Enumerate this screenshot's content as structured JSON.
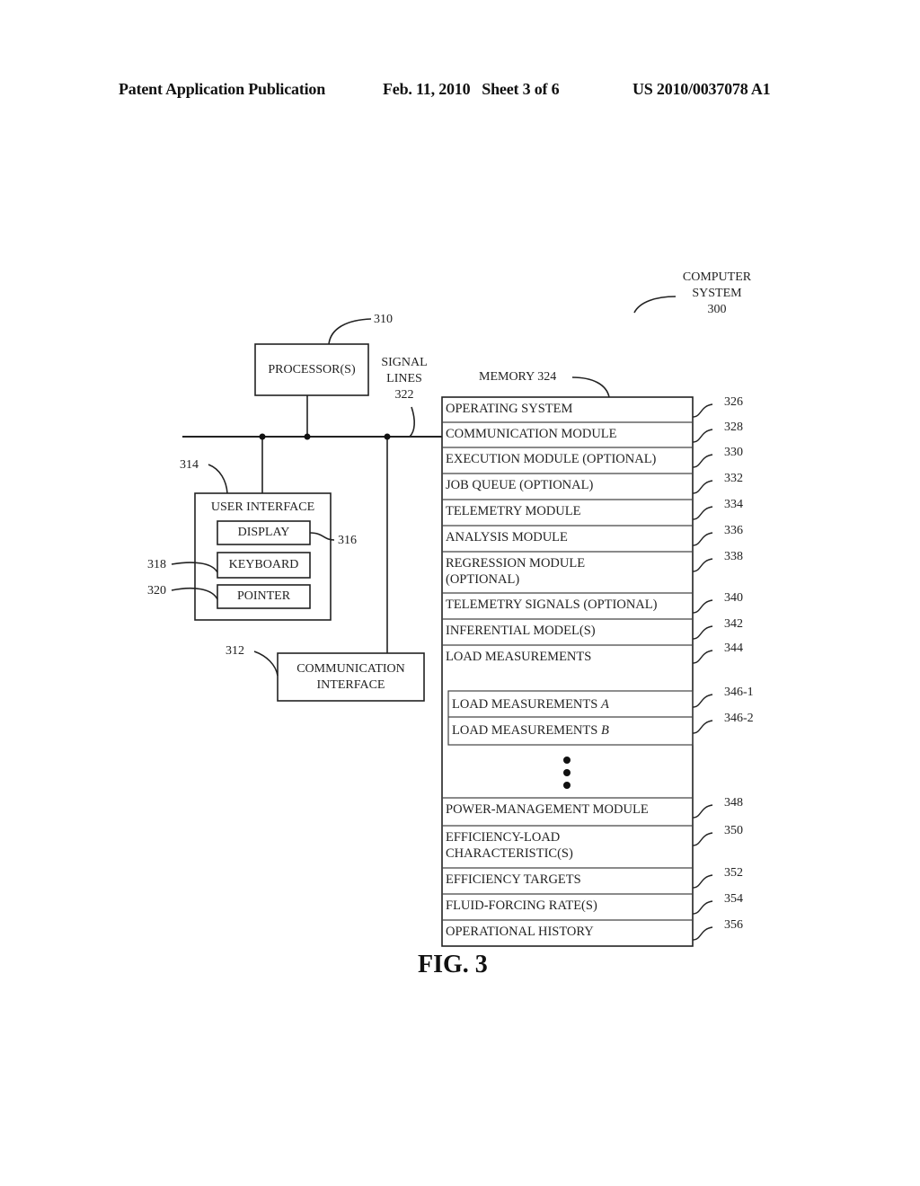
{
  "header": {
    "publication": "Patent Application Publication",
    "date_sheet": "Feb. 11, 2010   Sheet 3 of 6",
    "number": "US 2010/0037078 A1"
  },
  "system": {
    "title_lines": [
      "COMPUTER",
      "SYSTEM",
      "300"
    ]
  },
  "processor": {
    "label": "PROCESSOR(S)",
    "ref": "310"
  },
  "signal_lines": {
    "lines": [
      "SIGNAL",
      "LINES",
      "322"
    ]
  },
  "user_interface": {
    "label": "USER INTERFACE",
    "ref": "314",
    "display": {
      "label": "DISPLAY",
      "ref": "316"
    },
    "keyboard": {
      "label": "KEYBOARD",
      "ref": "318"
    },
    "pointer": {
      "label": "POINTER",
      "ref": "320"
    }
  },
  "communication_interface": {
    "lines": [
      "COMMUNICATION",
      "INTERFACE"
    ],
    "ref": "312"
  },
  "memory": {
    "label": "MEMORY 324",
    "rows": [
      {
        "lines": [
          "OPERATING SYSTEM"
        ],
        "ref": "326"
      },
      {
        "lines": [
          "COMMUNICATION MODULE"
        ],
        "ref": "328"
      },
      {
        "lines": [
          "EXECUTION MODULE (OPTIONAL)"
        ],
        "ref": "330"
      },
      {
        "lines": [
          "JOB QUEUE (OPTIONAL)"
        ],
        "ref": "332"
      },
      {
        "lines": [
          "TELEMETRY MODULE"
        ],
        "ref": "334"
      },
      {
        "lines": [
          "ANALYSIS MODULE"
        ],
        "ref": "336"
      },
      {
        "lines": [
          "REGRESSION MODULE",
          "(OPTIONAL)"
        ],
        "ref": "338"
      },
      {
        "lines": [
          "TELEMETRY SIGNALS (OPTIONAL)"
        ],
        "ref": "340"
      },
      {
        "lines": [
          "INFERENTIAL MODEL(S)"
        ],
        "ref": "342"
      },
      {
        "lines": [
          "LOAD MEASUREMENTS"
        ],
        "ref": "344"
      },
      {
        "lines": [
          "POWER-MANAGEMENT MODULE"
        ],
        "ref": "348"
      },
      {
        "lines": [
          "EFFICIENCY-LOAD",
          "CHARACTERISTIC(S)"
        ],
        "ref": "350"
      },
      {
        "lines": [
          "EFFICIENCY TARGETS"
        ],
        "ref": "352"
      },
      {
        "lines": [
          "FLUID-FORCING RATE(S)"
        ],
        "ref": "354"
      },
      {
        "lines": [
          "OPERATIONAL HISTORY"
        ],
        "ref": "356"
      }
    ],
    "load_sub": [
      {
        "prefix": "LOAD MEASUREMENTS ",
        "suffix": "A",
        "ref": "346-1"
      },
      {
        "prefix": "LOAD MEASUREMENTS ",
        "suffix": "B",
        "ref": "346-2"
      }
    ]
  },
  "figure_label": "FIG. 3"
}
